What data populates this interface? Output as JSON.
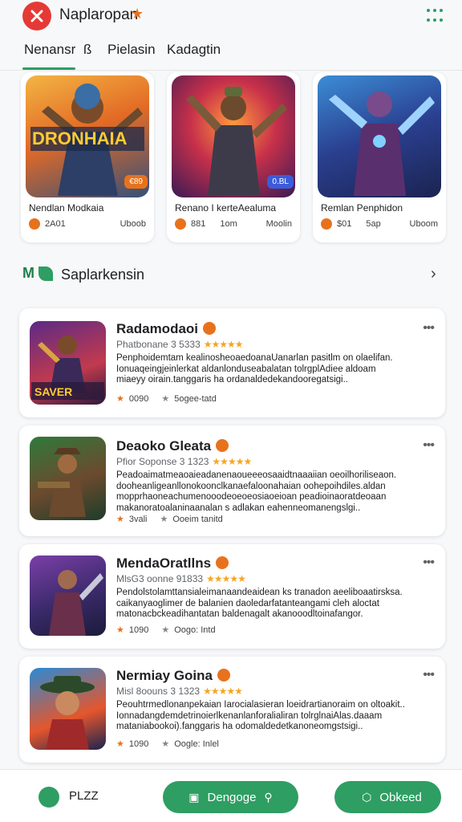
{
  "header": {
    "title": "Naplaropan",
    "star_glyph": "★",
    "menu_icon": "grid-icon"
  },
  "tabs": [
    "Nenansr",
    "ß",
    "Pielasin",
    "Kadagtin"
  ],
  "featured": [
    {
      "name": "Nendlan Modkaia",
      "badge": "€89",
      "stat1": "2A01",
      "stat2": "",
      "stat3": "Uboob",
      "art_text": "DRONHAIA",
      "badge_color": "#e8721c"
    },
    {
      "name": "Renano I kerteAealuma",
      "badge": "0.BL",
      "stat1": "881",
      "stat2": "1om",
      "stat3": "Moolin",
      "art_text": "",
      "badge_color": "#3b5bdb"
    },
    {
      "name": "Remlan Penphidon",
      "badge": "",
      "stat1": "$01",
      "stat2": "5ap",
      "stat3": "Uboom",
      "art_text": "",
      "badge_color": ""
    }
  ],
  "section": {
    "title": "Saplarkensin",
    "icon_text": "M"
  },
  "list": [
    {
      "title": "Radamodaoi",
      "sub": "Phatbonane 3 5333",
      "stars": "★★★★★",
      "desc": "Penphoidemtam kealinosheoaedoanaUanarlan pasitlm on olaelifan.\nIonuaqeingjeinlerkat aldanlonduseabalatan tolrgplAdiee aldoam\nmiaeyy oirain.tanggaris ha ordanaldedekandooregatsigi..",
      "foot1": "0090",
      "foot2": "5ogee-tatd",
      "art_text": "SAVER"
    },
    {
      "title": "Deaoko Gleata",
      "sub": "Pfior Soponse 3 1323",
      "stars": "★★★★★",
      "desc": "Peadoaimatmeaoaieadanenaoueeeosaaidtnaaaiian oeoilhoriliseaon.\ndooheanligeanllonokoonclkanaefaloonahaian oohepoihdiles.aldan\nmopprhaoneachumenooodeoeoeosiaoeioan peadioinaoratdeoaan\nmakanoratoalaninaanalan s adlakan eahenneomanengslgi..",
      "foot1": "3vali",
      "foot2": "Ooeim tanitd",
      "art_text": ""
    },
    {
      "title": "MendaOratllns",
      "sub": "MlsG3 oonne 91833",
      "stars": "★★★★★",
      "desc": "Pendolstolamttansialeimanaandeaidean ks tranadon aeeliboaatirsksa.\ncaikanyaoglimer de balanien daoledarfatanteangami cleh aloctat\nmatonacbckeadihantatan baldenagalt akanooodltoinafangor.",
      "foot1": "1090",
      "foot2": "Oogo: Intd",
      "art_text": ""
    },
    {
      "title": "Nermiay Goina",
      "sub": "Misl 8oouns 3 1323",
      "stars": "★★★★★",
      "desc": "Peouhtrmedlonanpekaian Iarocialasieran loeidrartianoraim on oltoakit..\nIonnadangdemdetrinoierlkenanlanforalialiran tolrglnaiAlas.daaam\nmataniabookoi).fanggaris ha odomaldedetkanoneomgstsigi..",
      "foot1": "1090",
      "foot2": "Oogle: Inlel",
      "art_text": ""
    }
  ],
  "bottom": {
    "chat_label": "PLZZ",
    "primary_label": "Dengoge",
    "secondary_label": "Obkeed"
  },
  "colors": {
    "accent": "#2e9e63",
    "orange": "#e8721c",
    "logo": "#e53935"
  }
}
